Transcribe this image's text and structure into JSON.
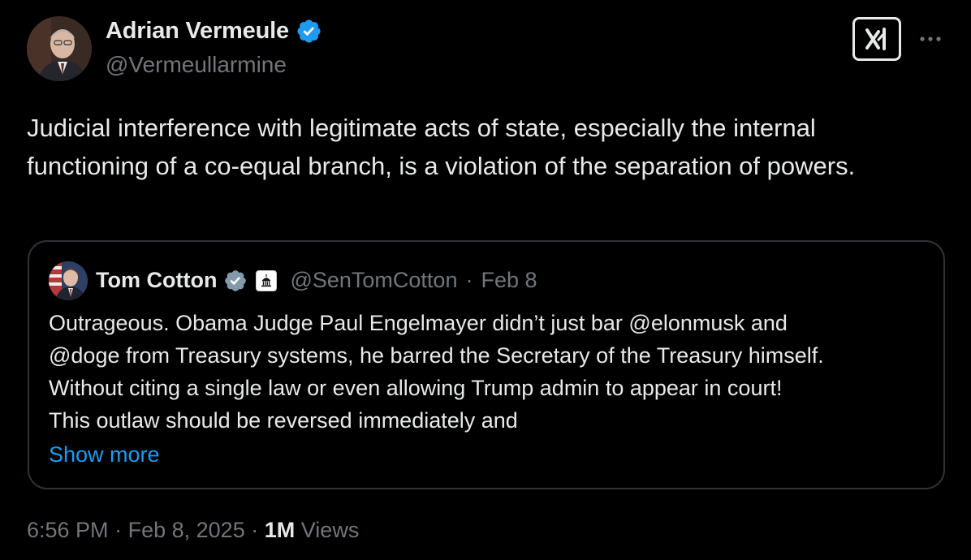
{
  "colors": {
    "background": "#000000",
    "text": "#e7e9ea",
    "muted": "#71767b",
    "accent": "#1d9bf0",
    "verified_blue": "#1d9bf0",
    "verified_gray": "#829aab",
    "border": "#2f3336"
  },
  "tweet": {
    "author": {
      "name": "Adrian Vermeule",
      "handle": "@Vermeullarmine",
      "verified_icon": "verified-badge-blue",
      "avatar_icon": "avatar"
    },
    "text": "Judicial interference with legitimate acts of state, especially the internal functioning of a co-equal branch, is a violation of the separation of powers.",
    "time": "6:56 PM",
    "separator": "·",
    "date": "Feb 8, 2025",
    "views_count": "1M",
    "views_label": "Views"
  },
  "header_actions": {
    "grok_icon": "grok-icon",
    "more_icon": "more-horizontal-icon"
  },
  "quote": {
    "author": {
      "name": "Tom Cotton",
      "handle": "@SenTomCotton",
      "verified_icon": "verified-badge-gray",
      "affiliation_icon": "capitol-building-icon"
    },
    "separator": "·",
    "date": "Feb 8",
    "lines": [
      "Outrageous. Obama Judge Paul Engelmayer didn’t just bar @elonmusk and",
      "@doge from Treasury systems, he barred the Secretary of the Treasury himself.",
      "Without citing a single law or even allowing Trump admin to appear in court!",
      "This outlaw should be reversed immediately and"
    ],
    "show_more": "Show more"
  }
}
